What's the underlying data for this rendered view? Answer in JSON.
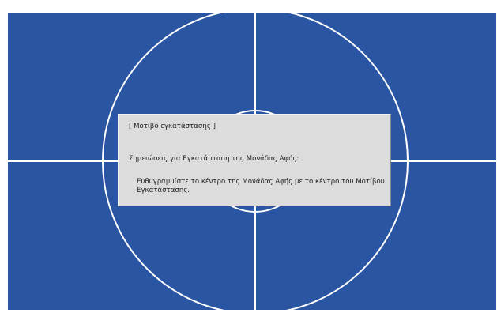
{
  "dialog": {
    "title": "[ Μοτίβο εγκατάστασης ]",
    "heading": "Σημειώσεις για Εγκατάσταση της Μονάδας Αφής:",
    "body": "Ευθυγραμμίστε το κέντρο της Μονάδας Αφής με το κέντρο του Μοτίβου Εγκατάστασης."
  },
  "colors": {
    "background_blue": "#2a55a3",
    "pattern_lines": "#ffffff",
    "dialog_bg": "#dcdcdc",
    "text": "#222222"
  }
}
